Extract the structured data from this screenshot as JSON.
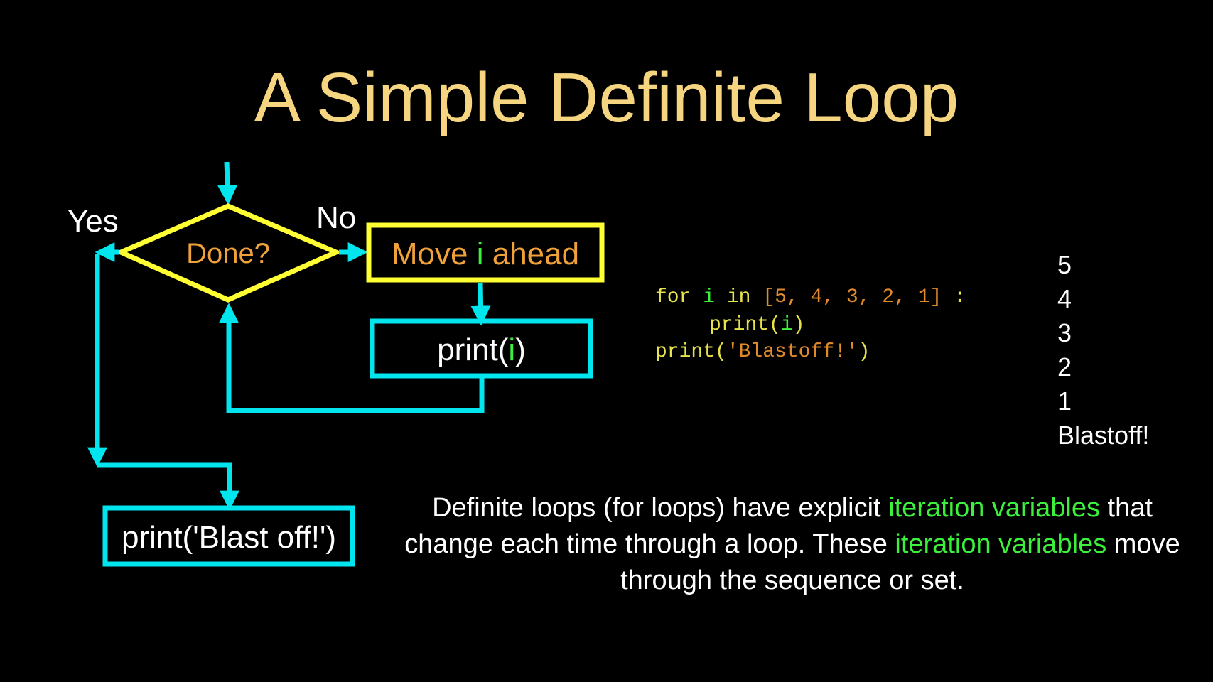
{
  "title": "A Simple Definite Loop",
  "colors": {
    "title": "#f6d580",
    "arrow": "#00e5ee",
    "decision_border": "#ffff33",
    "process_text": "#f0a23a",
    "highlight_green": "#3cf13c",
    "code_yellow": "#e6e34a",
    "code_orange": "#e08a2c"
  },
  "flowchart": {
    "yes_label": "Yes",
    "no_label": "No",
    "decision": "Done?",
    "move": {
      "before": "Move ",
      "var": "i",
      "after": " ahead"
    },
    "print_i": {
      "before": "print(",
      "var": "i",
      "after": ")"
    },
    "blast": "print('Blast off!')"
  },
  "code": {
    "line1": {
      "kw_for": "for",
      "var": "i",
      "kw_in": "in",
      "list": "[5, 4, 3, 2, 1]",
      "colon": ":"
    },
    "line2": {
      "fn": "print",
      "open": "(",
      "var": "i",
      "close": ")"
    },
    "line3": {
      "fn": "print",
      "open": "(",
      "str": "'Blastoff!'",
      "close": ")"
    }
  },
  "output": [
    "5",
    "4",
    "3",
    "2",
    "1",
    "Blastoff!"
  ],
  "paragraph": {
    "p1": "Definite loops (for loops) have explicit ",
    "h1": "iteration variables",
    "p2": " that change each time through a loop.  These ",
    "h2": "iteration variables",
    "p3": " move through the sequence or set."
  }
}
